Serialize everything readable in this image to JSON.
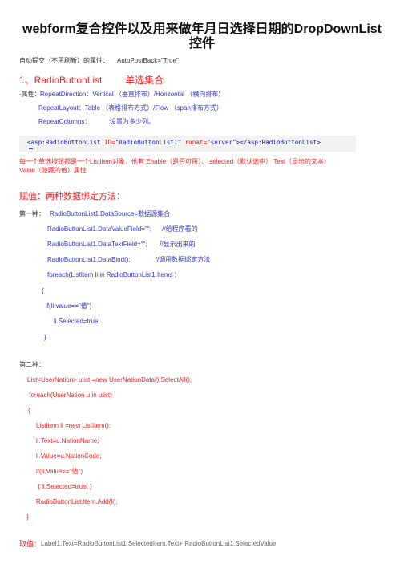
{
  "title": {
    "line1": "webform复合控件以及用来做年月日选择日期的DropDownList",
    "line2": "控件"
  },
  "autopostback": {
    "label": "自动提交（不用刷新）的属性：",
    "value": "AutoPostBack=\"True\""
  },
  "section1": {
    "heading_num": "1、RadioButtonList",
    "heading_cn": "单选集合",
    "props_label": "-属性：",
    "props": [
      "RepeatDirection：Vertical （垂直排布）/Horizontal （横向排布）",
      "RepeatLayout：Table （表格排布方式）/Flow （span排布方式）"
    ],
    "repeat_columns_label": "RepeatColumns：",
    "repeat_columns_desc": "设置为多少列。"
  },
  "code_sample": {
    "open_tag": "<asp:RadioButtonList",
    "id_attr": " ID=",
    "id_val": "\"RadioButtonList1\"",
    "runat_attr": " runat=",
    "runat_val": "\"server\"",
    "close": "></asp:RadioButtonList>"
  },
  "listitem_note": {
    "line1": "每一个单选按钮都是一个ListItem对象，他有  Enable（是否可用）、  selected（默认选中）  Text（显示的文本）",
    "line2": "Value（隐藏的值）属性"
  },
  "assign": {
    "heading": "赋值：两种数据绑定方法：",
    "first_label": "第一种：",
    "first_lines": [
      "RadioButtonList1.DataSource=数据源集合",
      "RadioButtonList1.DataValueField=\"\";      //给程序看的",
      "RadioButtonList1.DataTextField=\"\";       //显示出来的",
      "RadioButtonList1.DataBind();              //调用数据绑定方法",
      "foreach(ListItem li in RadioButtonList1.Items )",
      "{",
      "if(li.value==\"值\")",
      "li.Selected=true;",
      "}"
    ],
    "second_label": "第二种：",
    "second_lines": [
      "List<UserNation> ulist =new  UserNationData().SelectAll();",
      " foreach(UserNation u in ulist)",
      "{",
      "ListItem li =new ListItem();",
      "li.Text=u.NationName;",
      "li.Value=u.NationCode;",
      "if(li.Value==\"值\")",
      " { li.Selected=true; }",
      "RadioButtonList.Item.Add(li);",
      "}"
    ]
  },
  "getvalue": {
    "label": "取值：",
    "code": "Label1.Text=RadioButtonList1.SelectedItem.Text+ RadioButtonList1.SelectedValue"
  }
}
